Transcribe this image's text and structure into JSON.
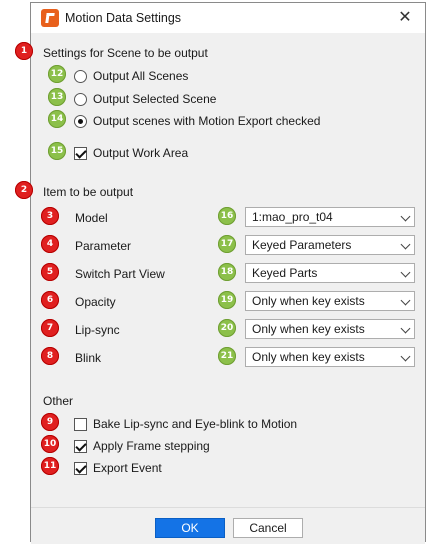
{
  "dialog": {
    "title": "Motion Data Settings",
    "close_label": "✕"
  },
  "scene_section": {
    "label": "Settings for Scene to be output",
    "options": [
      {
        "label": "Output All Scenes",
        "checked": false
      },
      {
        "label": "Output Selected Scene",
        "checked": false
      },
      {
        "label": "Output scenes with Motion Export checked",
        "checked": true
      }
    ],
    "work_area_label": "Output Work Area"
  },
  "items_section": {
    "label": "Item to be output",
    "items": [
      {
        "label": "Model",
        "value": "1:mao_pro_t04"
      },
      {
        "label": "Parameter",
        "value": "Keyed Parameters"
      },
      {
        "label": "Switch Part View",
        "value": "Keyed Parts"
      },
      {
        "label": "Opacity",
        "value": "Only when key exists"
      },
      {
        "label": "Lip-sync",
        "value": "Only when key exists"
      },
      {
        "label": "Blink",
        "value": "Only when key exists"
      }
    ]
  },
  "other_section": {
    "label": "Other",
    "options": [
      {
        "label": "Bake Lip-sync and Eye-blink to Motion",
        "checked": false
      },
      {
        "label": "Apply Frame stepping",
        "checked": true
      },
      {
        "label": "Export Event",
        "checked": true
      }
    ]
  },
  "footer": {
    "ok_label": "OK",
    "cancel_label": "Cancel"
  },
  "markers": {
    "red": [
      "1",
      "2",
      "3",
      "4",
      "5",
      "6",
      "7",
      "8",
      "9",
      "10",
      "11"
    ],
    "green": [
      "12",
      "13",
      "14",
      "15",
      "16",
      "17",
      "18",
      "19",
      "20",
      "21"
    ]
  },
  "colors": {
    "accent": "#1473e6",
    "marker_red": "#e02020",
    "marker_green": "#8cc04a",
    "app_icon": "#e8601c"
  }
}
